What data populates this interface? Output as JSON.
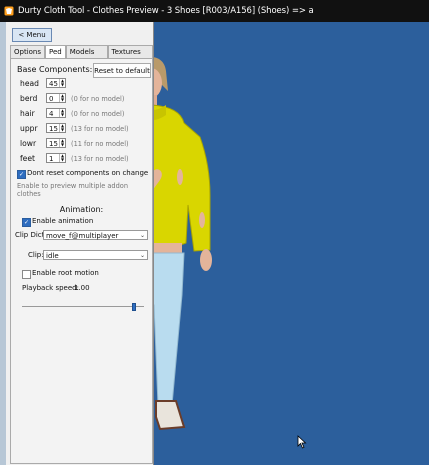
{
  "window": {
    "title": "Durty Cloth Tool - Clothes Preview - 3 Shoes [R003/A156] (Shoes) => a"
  },
  "menu": {
    "label": "< Menu"
  },
  "tabs": [
    {
      "label": "Options"
    },
    {
      "label": "Ped"
    },
    {
      "label": "Models data"
    },
    {
      "label": "Textures data"
    }
  ],
  "base": {
    "heading": "Base Components:",
    "reset_label": "Reset to default",
    "components": [
      {
        "label": "head",
        "value": "45",
        "hint": ""
      },
      {
        "label": "berd",
        "value": "0",
        "hint": "(0 for no model)"
      },
      {
        "label": "hair",
        "value": "4",
        "hint": "(0 for no model)"
      },
      {
        "label": "uppr",
        "value": "15",
        "hint": "(13 for no model)"
      },
      {
        "label": "lowr",
        "value": "15",
        "hint": "(11 for no model)"
      },
      {
        "label": "feet",
        "value": "1",
        "hint": "(13 for no model)"
      }
    ],
    "dont_reset_label": "Dont reset components on change",
    "enable_hint": "Enable to preview multiple addon clothes"
  },
  "animation": {
    "heading": "Animation:",
    "enable_label": "Enable animation",
    "clip_dict_label": "Clip Dict:",
    "clip_dict_value": "move_f@multiplayer",
    "clip_label": "Clip:",
    "clip_value": "idle",
    "root_motion_label": "Enable root motion",
    "playback_label": "Playback speed:",
    "playback_value": "1.00",
    "playback_fraction": 0.93
  },
  "colors": {
    "viewport_bg": "#2c5f9c",
    "sweater": "#d9d600",
    "jeans": "#b9dcef",
    "checkbox_accent": "#2e6dc0"
  },
  "icons": [
    "app-icon",
    "cursor-icon"
  ]
}
